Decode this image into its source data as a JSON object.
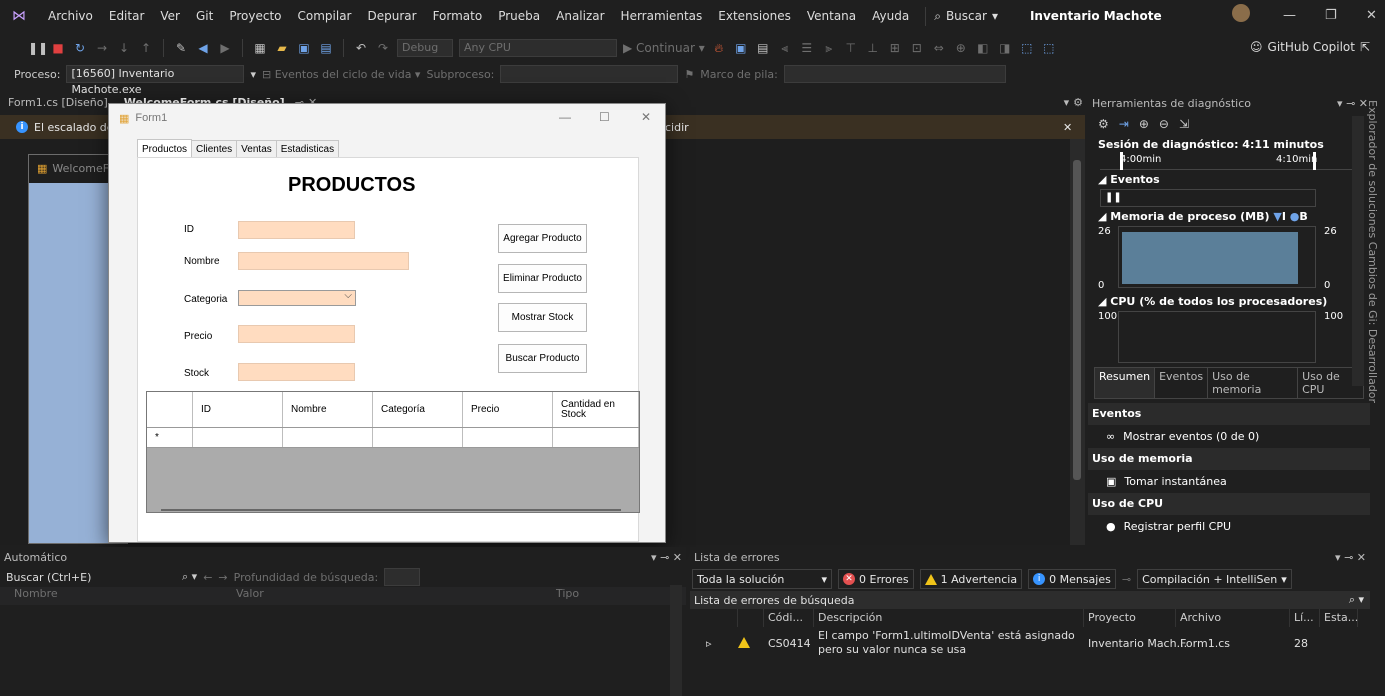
{
  "menu": {
    "items": [
      "Archivo",
      "Editar",
      "Ver",
      "Git",
      "Proyecto",
      "Compilar",
      "Depurar",
      "Formato",
      "Prueba",
      "Analizar",
      "Herramientas",
      "Extensiones",
      "Ventana",
      "Ayuda"
    ],
    "search": "Buscar",
    "app_title": "Inventario Machote"
  },
  "toolbar": {
    "config": "Debug",
    "platform": "Any CPU",
    "continue_label": "Continuar",
    "copilot": "GitHub Copilot"
  },
  "process_bar": {
    "process_label": "Proceso:",
    "process_value": "[16560] Inventario Machote.exe",
    "lifecycle": "Eventos del ciclo de vida",
    "thread_label": "Subproceso:",
    "stack_label": "Marco de pila:"
  },
  "doc_tabs": [
    {
      "label": "Form1.cs [Diseño]"
    },
    {
      "label": "WelcomeForm.cs [Diseño]"
    }
  ],
  "infobar": {
    "message": "El escalado de",
    "action": "cidir"
  },
  "welcome_form": {
    "title": "WelcomeFo"
  },
  "form1": {
    "title": "Form1",
    "tabs": [
      "Productos",
      "Clientes",
      "Ventas",
      "Estadisticas"
    ],
    "heading": "PRODUCTOS",
    "labels": {
      "id": "ID",
      "nombre": "Nombre",
      "categoria": "Categoria",
      "precio": "Precio",
      "stock": "Stock"
    },
    "buttons": {
      "agregar": "Agregar Producto",
      "eliminar": "Eliminar Producto",
      "mostrar": "Mostrar Stock",
      "buscar": "Buscar Producto"
    },
    "grid": {
      "columns": [
        "ID",
        "Nombre",
        "Categoría",
        "Precio",
        "Cantidad en Stock"
      ],
      "new_row_marker": "*"
    }
  },
  "diagnostics": {
    "title": "Herramientas de diagnóstico",
    "session": "Sesión de diagnóstico: 4:11 minutos",
    "time_ticks": [
      "4:00min",
      "4:10min"
    ],
    "events_header": "Eventos",
    "memory_header": "Memoria de proceso (MB)",
    "memory_legend": "I",
    "memory_legend2": "B",
    "memory_max": "26",
    "memory_min": "0",
    "memory_max_right": "26",
    "memory_min_right": "0",
    "cpu_header": "CPU (% de todos los procesadores)",
    "cpu_max": "100",
    "cpu_max_right": "100",
    "tabs": [
      "Resumen",
      "Eventos",
      "Uso de memoria",
      "Uso de CPU"
    ],
    "sec_events": "Eventos",
    "show_events": "Mostrar eventos (0 de 0)",
    "sec_memory": "Uso de memoria",
    "snapshot": "Tomar instantánea",
    "sec_cpu": "Uso de CPU",
    "cpu_profile": "Registrar perfil CPU"
  },
  "side_panel": {
    "text": "Explorador de soluciones   Cambios de Gi: Desarrollador"
  },
  "auto": {
    "title": "Automático",
    "search": "Buscar (Ctrl+E)",
    "depth": "Profundidad de búsqueda:",
    "columns": [
      "Nombre",
      "Valor",
      "Tipo"
    ]
  },
  "errors": {
    "title": "Lista de errores",
    "scope": "Toda la solución",
    "errors": "0 Errores",
    "warnings": "1 Advertencia",
    "messages": "0 Mensajes",
    "build": "Compilación + IntelliSen",
    "search_label": "Lista de errores de búsqueda",
    "columns": [
      "Códi...",
      "Descripción",
      "Proyecto",
      "Archivo",
      "Lí...",
      "Esta..."
    ],
    "row": {
      "code": "CS0414",
      "description": "El campo 'Form1.ultimoIDVenta' está asignado pero su valor nunca se usa",
      "project": "Inventario Mach...",
      "file": "Form1.cs",
      "line": "28"
    }
  },
  "colors": {
    "accent": "#9184ee",
    "textbox_fill": "#ffdcc0",
    "memory_fill": "#5b7f99",
    "warning": "#f0c419"
  }
}
